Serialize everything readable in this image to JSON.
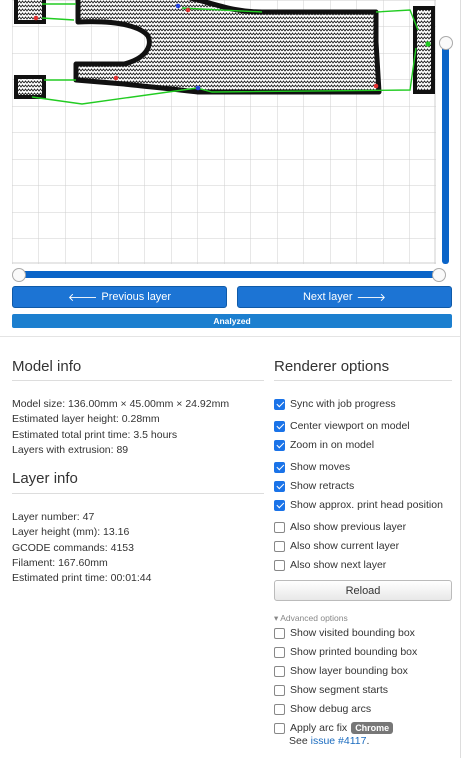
{
  "controls": {
    "previous_layer": "Previous layer",
    "next_layer": "Next layer",
    "analyzed": "Analyzed"
  },
  "model_info": {
    "title": "Model info",
    "lines": [
      "Model size: 136.00mm × 45.00mm × 24.92mm",
      "Estimated layer height: 0.28mm",
      "Estimated total print time: 3.5 hours",
      "Layers with extrusion: 89"
    ]
  },
  "layer_info": {
    "title": "Layer info",
    "lines": [
      "Layer number: 47",
      "Layer height (mm): 13.16",
      "GCODE commands: 4153",
      "Filament: 167.60mm",
      "Estimated print time: 00:01:44"
    ]
  },
  "renderer": {
    "title": "Renderer options",
    "options": [
      {
        "label": "Sync with job progress",
        "checked": true
      },
      {
        "label": "Center viewport on model",
        "checked": true
      },
      {
        "label": "Zoom in on model",
        "checked": true
      },
      {
        "label": "Show moves",
        "checked": true
      },
      {
        "label": "Show retracts",
        "checked": true
      },
      {
        "label": "Show approx. print head position",
        "checked": true
      },
      {
        "label": "Also show previous layer",
        "checked": false
      },
      {
        "label": "Also show current layer",
        "checked": false
      },
      {
        "label": "Also show next layer",
        "checked": false
      }
    ],
    "reload": "Reload",
    "advanced_label": "Advanced options",
    "advanced": [
      {
        "label": "Show visited bounding box",
        "checked": false
      },
      {
        "label": "Show printed bounding box",
        "checked": false
      },
      {
        "label": "Show layer bounding box",
        "checked": false
      },
      {
        "label": "Show segment starts",
        "checked": false
      },
      {
        "label": "Show debug arcs",
        "checked": false
      },
      {
        "label": "Apply arc fix",
        "checked": false
      }
    ],
    "chrome_badge": "Chrome",
    "see_text": "See",
    "issue_link": "issue #4117",
    "see_suffix": "."
  },
  "sliders": {
    "layer_progress": 0.17,
    "command_range": [
      0,
      1
    ]
  },
  "colors": {
    "accent": "#1c74d4",
    "grid": "#cfcfcf",
    "extrusion": "#111111",
    "move": "#22cc22"
  }
}
